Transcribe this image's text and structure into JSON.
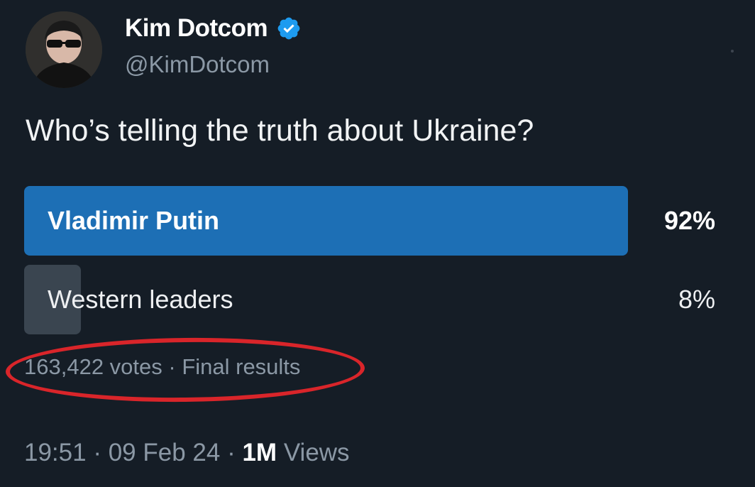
{
  "author": {
    "display_name": "Kim Dotcom",
    "handle": "@KimDotcom",
    "verified": true,
    "verified_badge_icon": "verified-badge-icon",
    "badge_color": "#1d9bf0"
  },
  "tweet": {
    "text": "Who’s telling the truth about Ukraine?"
  },
  "poll": {
    "options": [
      {
        "label": "Vladimir Putin",
        "percent_text": "92%",
        "percent": 92,
        "winner": true,
        "fill_color": "#1d6fb5"
      },
      {
        "label": "Western leaders",
        "percent_text": "8%",
        "percent": 8,
        "winner": false,
        "fill_color": "#3a4550"
      }
    ],
    "meta": "163,422 votes · Final results"
  },
  "footer": {
    "time": "19:51",
    "separator": "·",
    "date": "09 Feb 24",
    "views_count": "1M",
    "views_label": "Views"
  },
  "colors": {
    "background": "#151d26",
    "secondary_text": "#8b98a5",
    "annotation_ring": "#d9252a"
  }
}
